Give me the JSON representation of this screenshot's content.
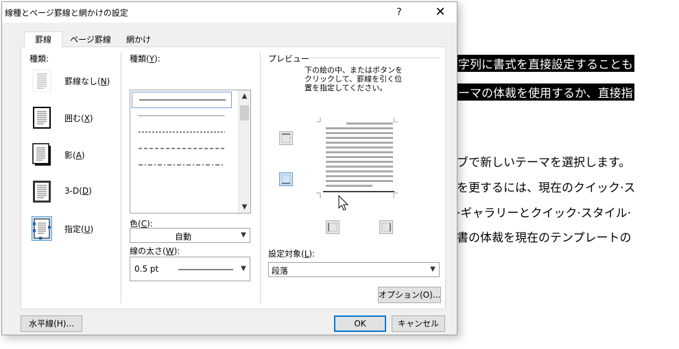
{
  "dialog": {
    "title": "線種とページ罫線と網かけの設定",
    "help": "?",
    "close": "✕"
  },
  "tabs": [
    {
      "label": "罫線",
      "active": true
    },
    {
      "label": "ページ罫線",
      "active": false
    },
    {
      "label": "網かけ",
      "active": false
    }
  ],
  "setting": {
    "label": "種類:",
    "items": [
      {
        "label": "罫線なし(",
        "key": "N",
        "tail": ")"
      },
      {
        "label": "囲む(",
        "key": "X",
        "tail": ")"
      },
      {
        "label": "影(",
        "key": "A",
        "tail": ")"
      },
      {
        "label": "3-D(",
        "key": "D",
        "tail": ")"
      },
      {
        "label": "指定(",
        "key": "U",
        "tail": ")"
      }
    ],
    "selected_index": 4
  },
  "style": {
    "label": "種類(",
    "key": "Y",
    "tail": "):",
    "items": [
      "solid",
      "dotted-fine",
      "dashed-small",
      "dashed",
      "dash-dot"
    ],
    "selected_index": 0
  },
  "color": {
    "label": "色(",
    "key": "C",
    "tail": "):",
    "value": "自動"
  },
  "width": {
    "label": "線の太さ(",
    "key": "W",
    "tail": "):",
    "value": "0.5 pt"
  },
  "preview": {
    "label": "プレビュー",
    "instructions": [
      "下の絵の中、またはボタンを",
      "クリックして、罫線を引く位",
      "置を指定してください。"
    ]
  },
  "apply_to": {
    "label": "設定対象(",
    "key": "L",
    "tail": "):",
    "value": "段落"
  },
  "buttons": {
    "options": "オプション(O)...",
    "horizontal_line": "水平線(H)...",
    "ok": "OK",
    "cancel": "キャンセル"
  },
  "background_document": {
    "lines": [
      "字列に書式を直接設定することも",
      "ーマの体裁を使用するか、直接指",
      "ブで新しいテーマを選択します。",
      "を更するには、現在のクイック·ス",
      "·ギャラリーとクイック·スタイル·",
      "書の体裁を現在のテンプレートの"
    ]
  },
  "colors": {
    "accent": "#0078d7",
    "dialog_bg": "#f0f0f0",
    "panel_bg": "#ffffff"
  },
  "icons": {
    "setting_none": "border-none-icon",
    "setting_box": "border-box-icon",
    "setting_shadow": "border-shadow-icon",
    "setting_3d": "border-3d-icon",
    "setting_custom": "border-custom-icon",
    "preview_top": "border-top-icon",
    "preview_bottom": "border-bottom-icon",
    "preview_left": "border-left-icon",
    "preview_right": "border-right-icon",
    "cursor": "mouse-pointer-icon"
  }
}
